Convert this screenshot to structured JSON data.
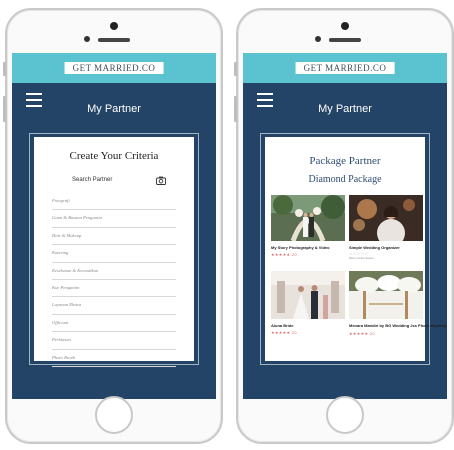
{
  "left_screen": {
    "brand": "GET MARRIED.CO",
    "title": "My Partner",
    "card_title": "Create Your Criteria",
    "search_placeholder": "Search Partner",
    "criteria": [
      "Fotografi",
      "Gaun & Busana Pengantin",
      "Hair & Makeup",
      "Katering",
      "Kesehatan & Kecantikan",
      "Kue Pengantin",
      "Layanan Ekstra",
      "Officiant",
      "Perhiasan",
      "Photo Booth"
    ]
  },
  "right_screen": {
    "brand": "GET MARRIED.CO",
    "title": "My Partner",
    "card_title": "Package Partner",
    "card_subtitle": "Diamond Package",
    "partners": [
      {
        "name": "My Story Photography & Video",
        "stars": "★★★★★ 20",
        "note": ""
      },
      {
        "name": "Simple Wedding Organizer",
        "stars": "☆☆☆☆☆",
        "note": "Belum Ada Ulasan"
      },
      {
        "name": "Aluna Bride",
        "stars": "★★★★★ 20",
        "note": ""
      },
      {
        "name": "Menara Mandiri by BG Wedding Jss Photo Bayanay",
        "stars": "★★★★★ 20",
        "note": ""
      }
    ]
  },
  "colors": {
    "screen_bg": "#234467",
    "brand_bar": "#5bc3d0",
    "title_blue": "#2e4d72",
    "star": "#e06a6a"
  },
  "icons": {
    "menu": "hamburger-icon",
    "camera": "camera-icon"
  }
}
